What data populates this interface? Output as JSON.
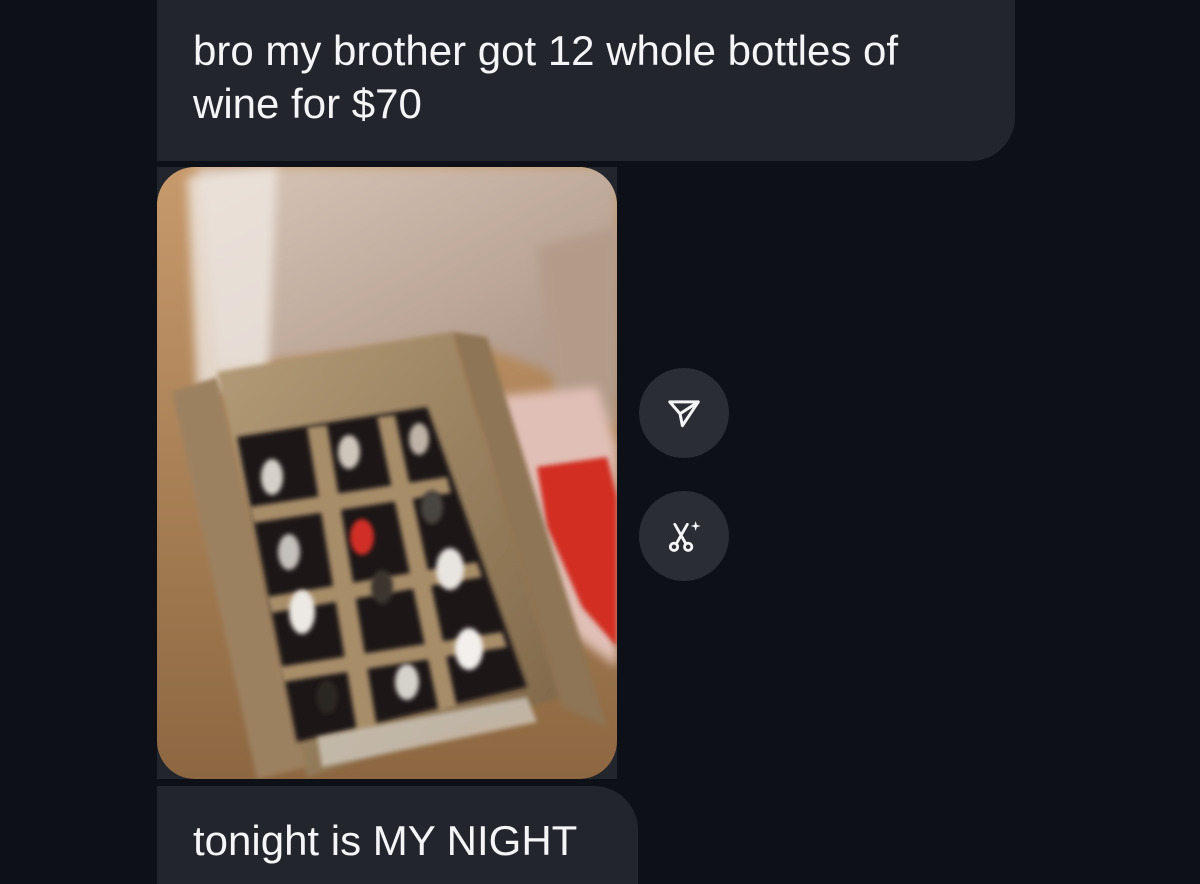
{
  "messages": [
    {
      "text": "bro my brother got 12 whole bottles of wine for $70"
    },
    {
      "text": "tonight is MY NIGHT"
    }
  ],
  "photo": {
    "subject": "wine-case-photo"
  },
  "actions": {
    "share_icon": "send-icon",
    "cutout_icon": "scissors-sparkle-icon"
  },
  "colors": {
    "background": "#0d1016",
    "bubble": "#22252b",
    "text": "#f4f5f7",
    "action_button": "#2a2d33"
  }
}
